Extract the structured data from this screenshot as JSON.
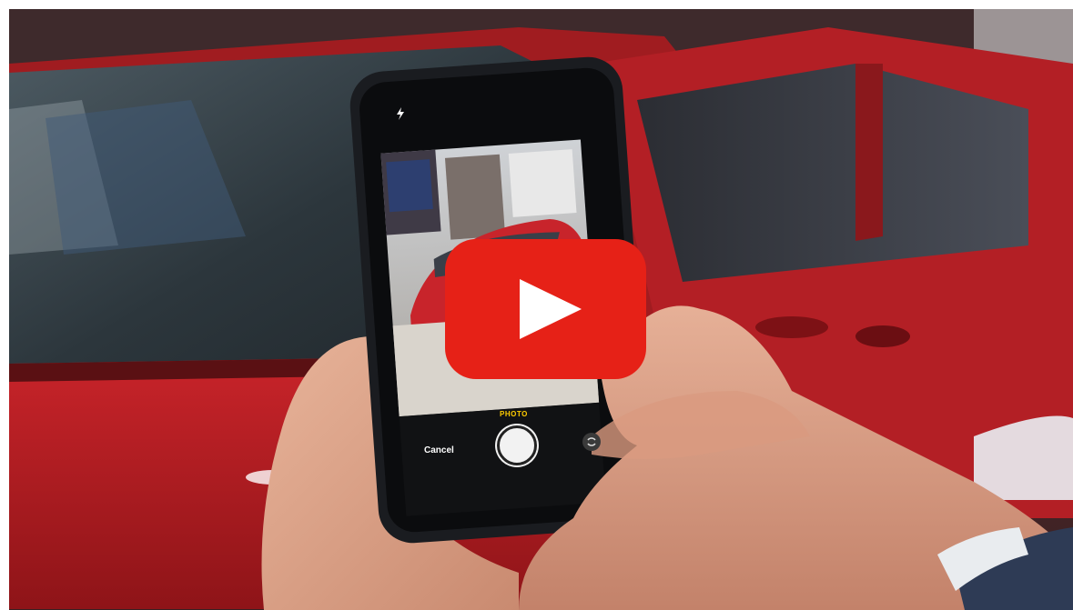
{
  "video": {
    "camera_mode": "PHOTO",
    "cancel_label": "Cancel",
    "play_icon": "youtube-play-icon",
    "flash_icon": "flash-icon",
    "flip_icon": "camera-flip-icon"
  },
  "colors": {
    "youtube_red": "#e62117",
    "car_red": "#b01e22",
    "camera_mode_yellow": "#ffcc00"
  }
}
